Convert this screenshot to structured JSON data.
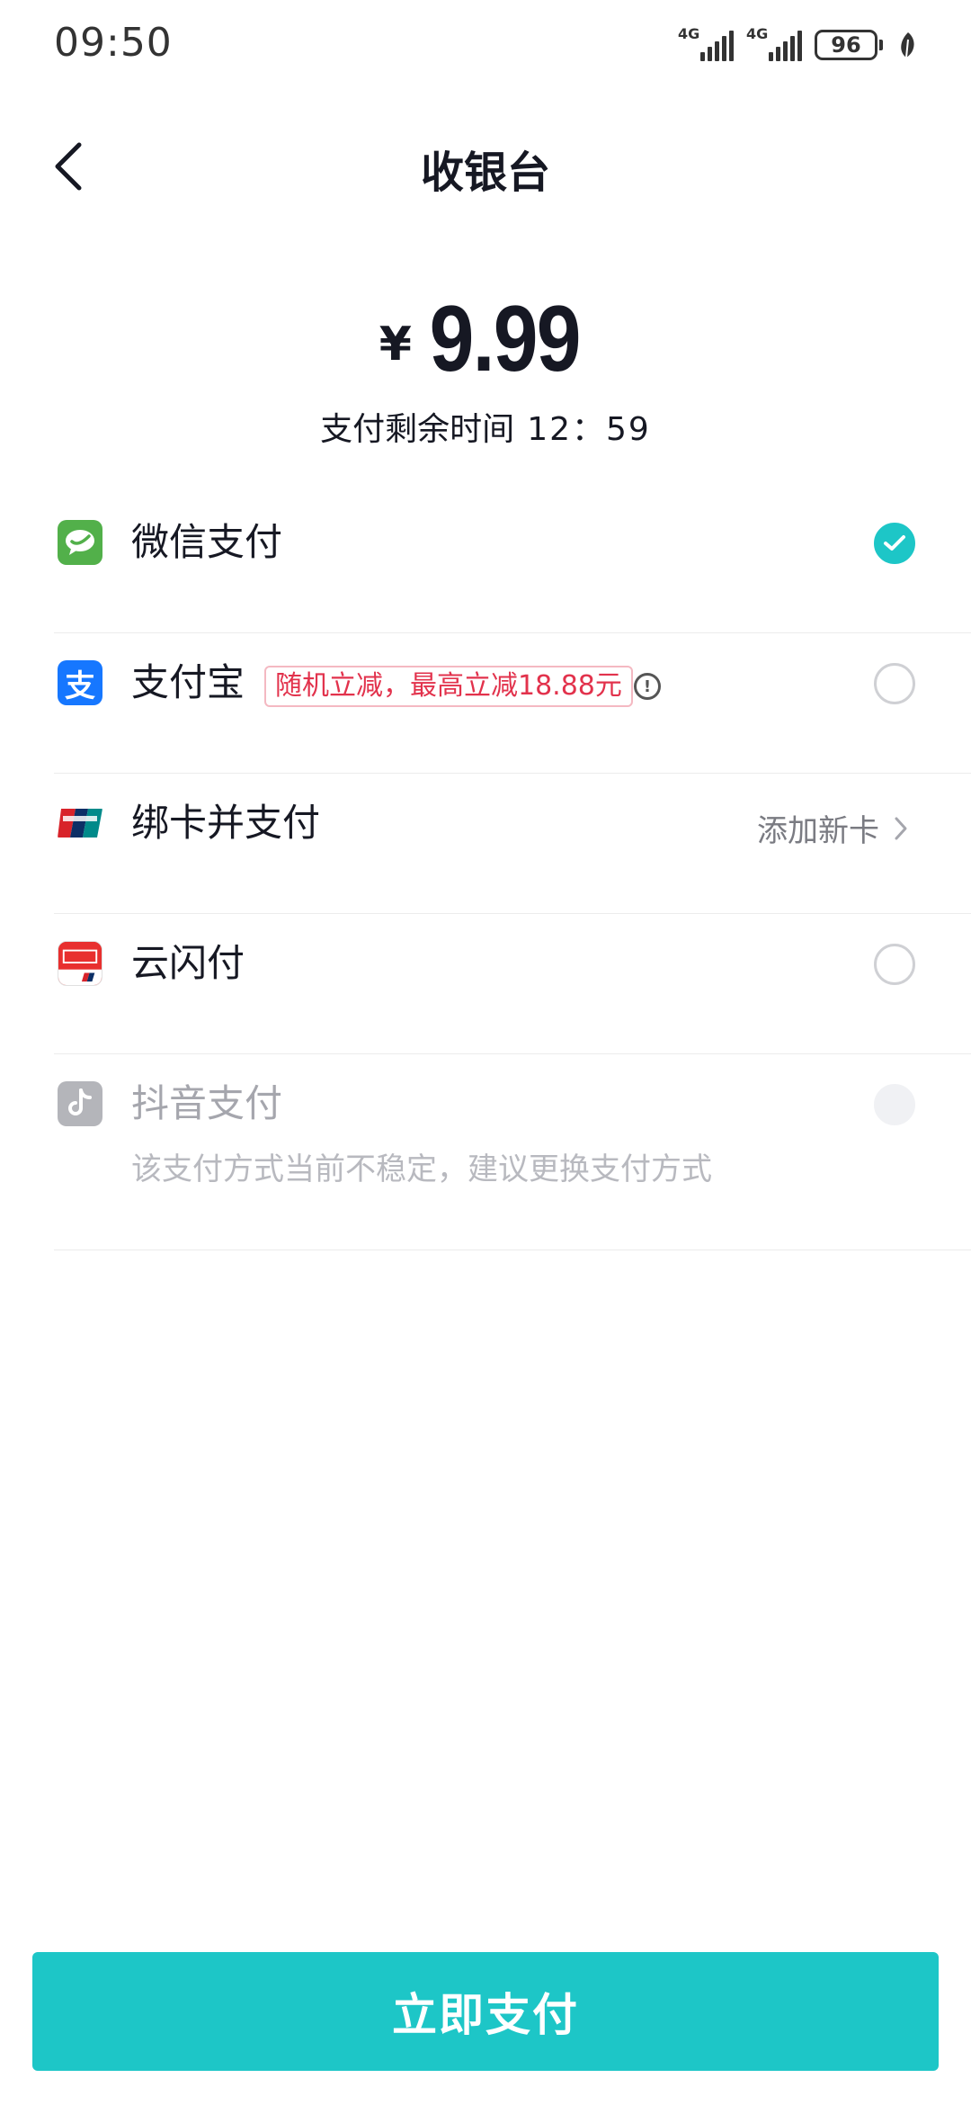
{
  "status_bar": {
    "time": "09:50",
    "network_1": "4G",
    "network_2": "4G",
    "battery_level": "96"
  },
  "header": {
    "title": "收银台"
  },
  "amount": {
    "currency": "¥",
    "value": "9.99"
  },
  "countdown": {
    "label": "支付剩余时间",
    "time": "12：59"
  },
  "payment_methods": [
    {
      "name": "微信支付",
      "state": "selected",
      "icon": "wechat-pay-icon",
      "color": "#52b04a"
    },
    {
      "name": "支付宝",
      "state": "unselected",
      "icon": "alipay-icon",
      "color": "#1677ff",
      "promo": "随机立减，最高立减18.88元"
    },
    {
      "name": "绑卡并支付",
      "icon": "unionpay-icon",
      "action_label": "添加新卡"
    },
    {
      "name": "云闪付",
      "state": "unselected",
      "icon": "cloud-quickpass-icon",
      "color": "#e8302f"
    },
    {
      "name": "抖音支付",
      "state": "disabled",
      "icon": "douyin-pay-icon",
      "note": "该支付方式当前不稳定，建议更换支付方式"
    }
  ],
  "pay_button": {
    "label": "立即支付"
  },
  "colors": {
    "accent": "#1dc6c7",
    "promo_red": "#e2324c"
  }
}
